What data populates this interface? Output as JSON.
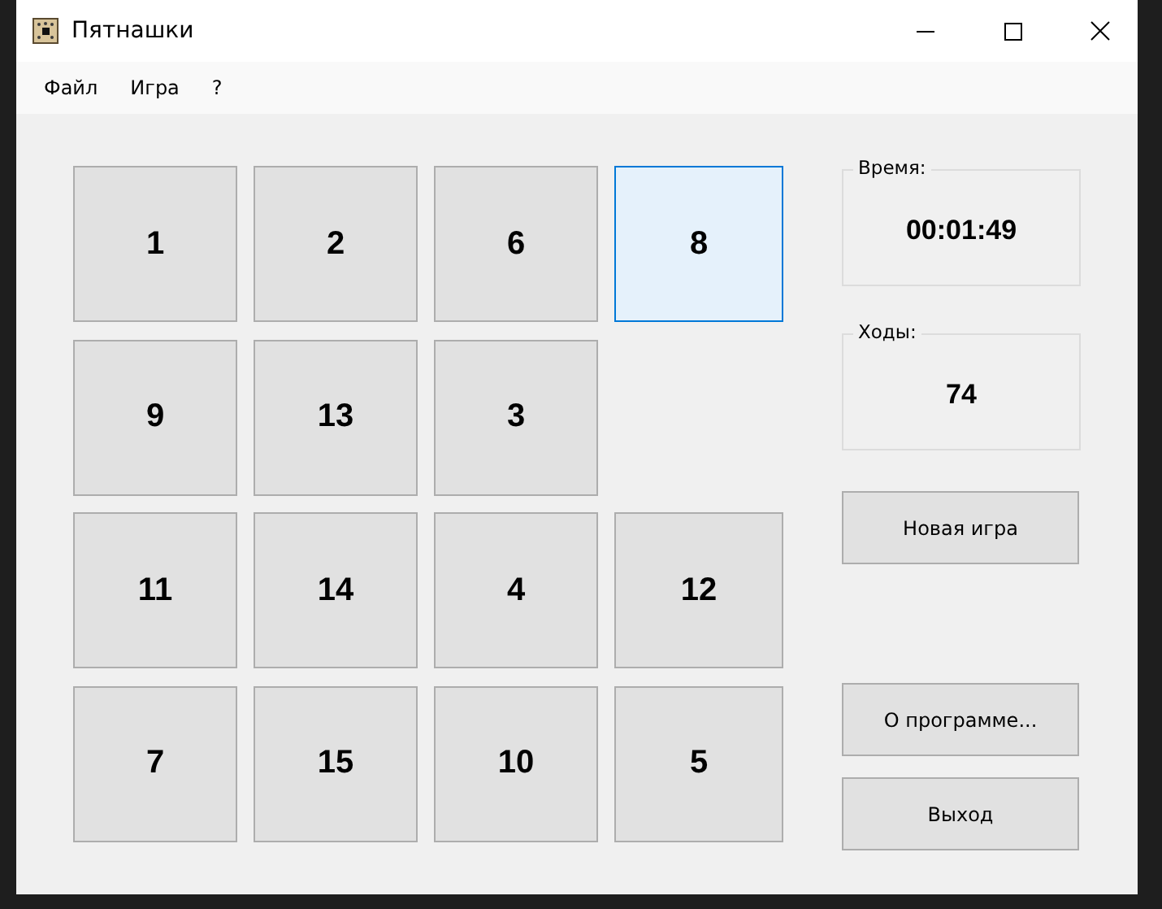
{
  "window": {
    "title": "Пятнашки"
  },
  "menu": [
    {
      "label": "Файл"
    },
    {
      "label": "Игра"
    },
    {
      "label": "?"
    }
  ],
  "tiles": [
    {
      "kind": "tile",
      "label": "1",
      "highlighted": false
    },
    {
      "kind": "tile",
      "label": "2",
      "highlighted": false
    },
    {
      "kind": "tile",
      "label": "6",
      "highlighted": false
    },
    {
      "kind": "tile",
      "label": "8",
      "highlighted": true
    },
    {
      "kind": "tile",
      "label": "9",
      "highlighted": false
    },
    {
      "kind": "tile",
      "label": "13",
      "highlighted": false
    },
    {
      "kind": "tile",
      "label": "3",
      "highlighted": false
    },
    {
      "kind": "empty"
    },
    {
      "kind": "tile",
      "label": "11",
      "highlighted": false
    },
    {
      "kind": "tile",
      "label": "14",
      "highlighted": false
    },
    {
      "kind": "tile",
      "label": "4",
      "highlighted": false
    },
    {
      "kind": "tile",
      "label": "12",
      "highlighted": false
    },
    {
      "kind": "tile",
      "label": "7",
      "highlighted": false
    },
    {
      "kind": "tile",
      "label": "15",
      "highlighted": false
    },
    {
      "kind": "tile",
      "label": "10",
      "highlighted": false
    },
    {
      "kind": "tile",
      "label": "5",
      "highlighted": false
    }
  ],
  "time": {
    "label": "Время:",
    "value": "00:01:49"
  },
  "moves": {
    "label": "Ходы:",
    "value": "74"
  },
  "buttons": {
    "new_game": "Новая игра",
    "about": "О программе...",
    "exit": "Выход"
  }
}
